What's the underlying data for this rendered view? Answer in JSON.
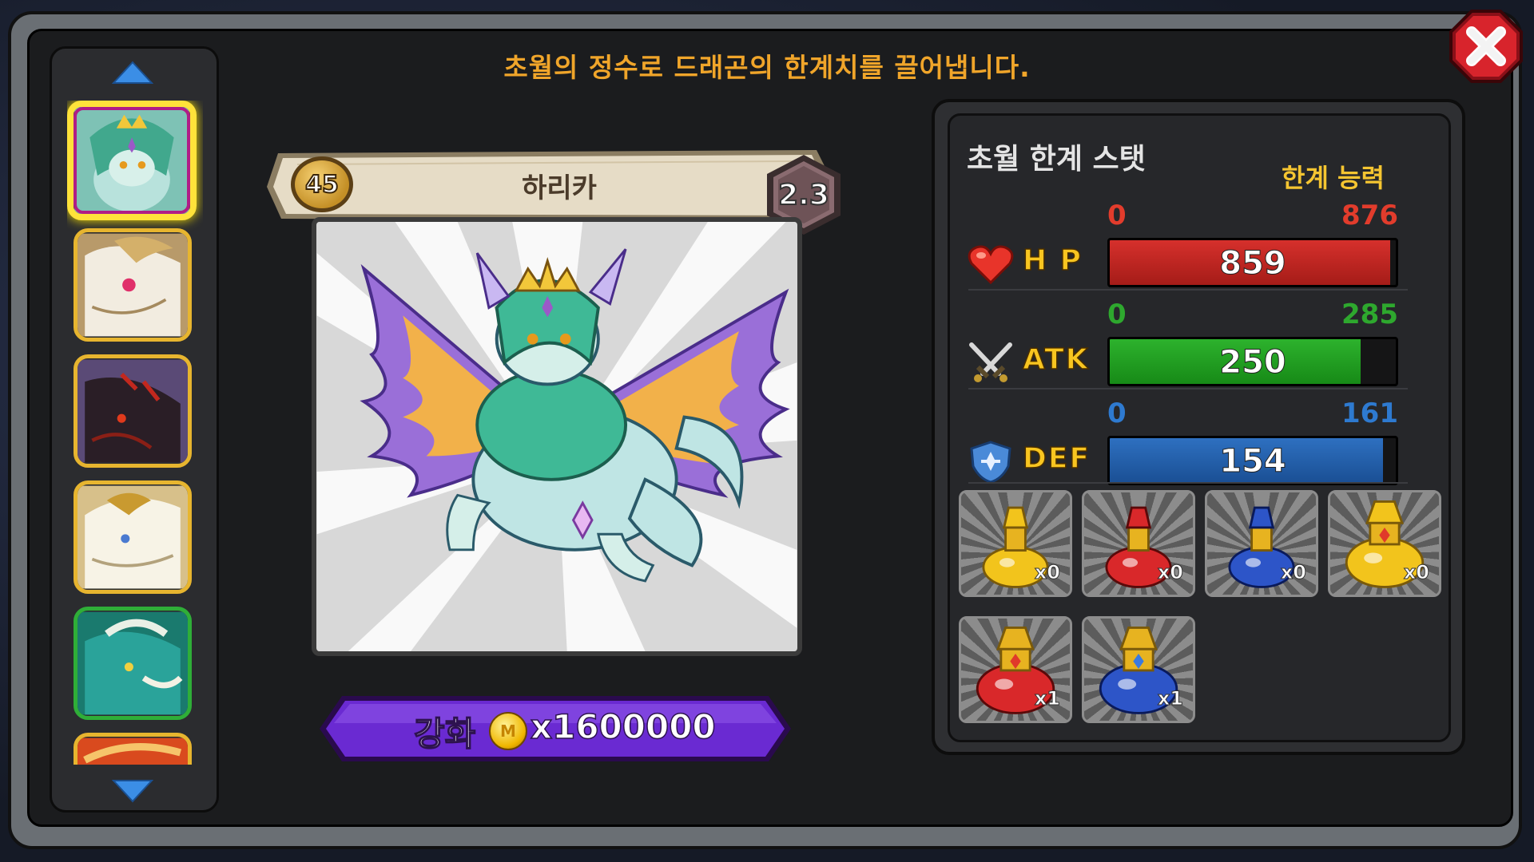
{
  "header": {
    "subtitle": "초월의 정수로 드래곤의 한계치를 끌어냅니다."
  },
  "close_icon": "close-x-icon",
  "sidebar": {
    "scroll_up_icon": "triangle-up-icon",
    "scroll_down_icon": "triangle-down-icon",
    "dragons": [
      {
        "id": "slot-1",
        "theme": "#8fd1c1",
        "selected": true
      },
      {
        "id": "slot-2",
        "theme": "#e8d9c0",
        "selected": false
      },
      {
        "id": "slot-3",
        "theme": "#3a2a3a",
        "selected": false
      },
      {
        "id": "slot-4",
        "theme": "#f0ead8",
        "selected": false
      },
      {
        "id": "slot-5",
        "theme": "#2aa39a",
        "selected": false
      },
      {
        "id": "slot-6",
        "theme": "#d94a1e",
        "selected": false
      }
    ]
  },
  "dragon": {
    "level": "45",
    "name": "하리카",
    "grade": "2.3"
  },
  "upgrade": {
    "label": "강화",
    "coin_symbol": "M",
    "cost": "x1600000"
  },
  "stats": {
    "title": "초월 한계 스탯",
    "limit_label": "한계 능력",
    "rows": [
      {
        "name": "H P",
        "icon": "heart-icon",
        "min": "0",
        "max": "876",
        "value": "859",
        "fraction": 0.98,
        "color": "#c62622",
        "label_color": "#e23c2c"
      },
      {
        "name": "ATK",
        "icon": "crossed-swords-icon",
        "min": "0",
        "max": "285",
        "value": "250",
        "fraction": 0.877,
        "color": "#1e9e1e",
        "label_color": "#2ea82e"
      },
      {
        "name": "DEF",
        "icon": "shield-icon",
        "min": "0",
        "max": "161",
        "value": "154",
        "fraction": 0.956,
        "color": "#1e5ea8",
        "label_color": "#2e7ad0"
      }
    ]
  },
  "potions": [
    {
      "color": "#f2c41c",
      "count": "x0",
      "style": "small"
    },
    {
      "color": "#d9282a",
      "count": "x0",
      "style": "small"
    },
    {
      "color": "#2d55c8",
      "count": "x0",
      "style": "small"
    },
    {
      "color": "#f2c41c",
      "count": "x0",
      "style": "large"
    },
    {
      "color": "#d9282a",
      "count": "x1",
      "style": "large"
    },
    {
      "color": "#2d55c8",
      "count": "x1",
      "style": "large"
    }
  ]
}
